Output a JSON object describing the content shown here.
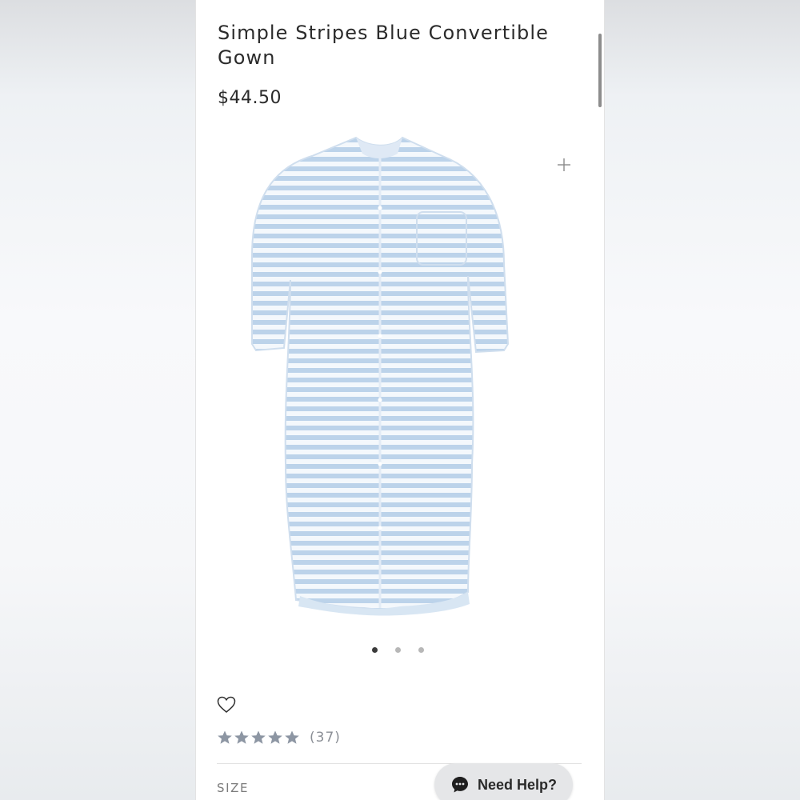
{
  "product": {
    "title": "Simple Stripes Blue Convertible Gown",
    "price": "$44.50"
  },
  "gallery": {
    "image_icon": "striped-baby-gown-image",
    "zoom_icon": "plus-icon",
    "slides_total": 3,
    "active_slide": 1
  },
  "wishlist": {
    "icon": "heart-outline-icon"
  },
  "rating": {
    "stars": 5,
    "filled_stars": 5,
    "count": "(37)",
    "star_color": "#8d96a3"
  },
  "options": {
    "size_label": "SIZE"
  },
  "support": {
    "label": "Need Help?",
    "icon": "chat-bubble-icon"
  },
  "colors": {
    "stripe_blue": "#bcd3ea",
    "gown_base": "#f4f8fc",
    "text": "#2b2b2b",
    "help_bg": "#e5e6e8"
  }
}
